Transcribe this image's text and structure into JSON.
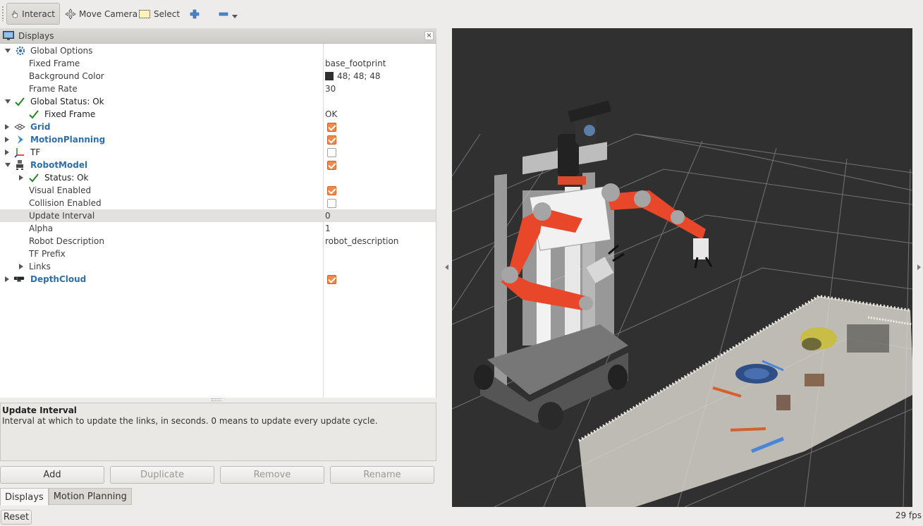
{
  "toolbar": {
    "interact_label": "Interact",
    "move_camera_label": "Move Camera",
    "select_label": "Select"
  },
  "displays_panel": {
    "title": "Displays",
    "close": "×"
  },
  "tree": {
    "global_options": "Global Options",
    "fixed_frame_label": "Fixed Frame",
    "fixed_frame_value": "base_footprint",
    "background_color_label": "Background Color",
    "background_color_value": "48; 48; 48",
    "background_color_hex": "#303030",
    "frame_rate_label": "Frame Rate",
    "frame_rate_value": "30",
    "global_status_label": "Global Status: Ok",
    "fixed_frame_status_label": "Fixed Frame",
    "fixed_frame_status_value": "OK",
    "grid_label": "Grid",
    "motion_planning_label": "MotionPlanning",
    "tf_label": "TF",
    "robot_model_label": "RobotModel",
    "status_ok_label": "Status: Ok",
    "visual_enabled_label": "Visual Enabled",
    "collision_enabled_label": "Collision Enabled",
    "update_interval_label": "Update Interval",
    "update_interval_value": "0",
    "alpha_label": "Alpha",
    "alpha_value": "1",
    "robot_description_label": "Robot Description",
    "robot_description_value": "robot_description",
    "tf_prefix_label": "TF Prefix",
    "links_label": "Links",
    "depth_cloud_label": "DepthCloud",
    "checked": {
      "grid": true,
      "motion_planning": true,
      "tf": false,
      "robot_model": true,
      "visual_enabled": true,
      "collision_enabled": false,
      "depth_cloud": true
    }
  },
  "description": {
    "title": "Update Interval",
    "text": "Interval at which to update the links, in seconds. 0 means to update every update cycle."
  },
  "buttons": {
    "add": "Add",
    "duplicate": "Duplicate",
    "remove": "Remove",
    "rename": "Rename"
  },
  "tabs": {
    "displays": "Displays",
    "motion_planning": "Motion Planning"
  },
  "status": {
    "reset": "Reset",
    "fps": "29 fps"
  },
  "colors": {
    "accent_checkbox": "#f08a4b",
    "link_blue": "#2f6fa8",
    "viewport_bg": "#303030",
    "robot_arm": "#e8472a"
  }
}
